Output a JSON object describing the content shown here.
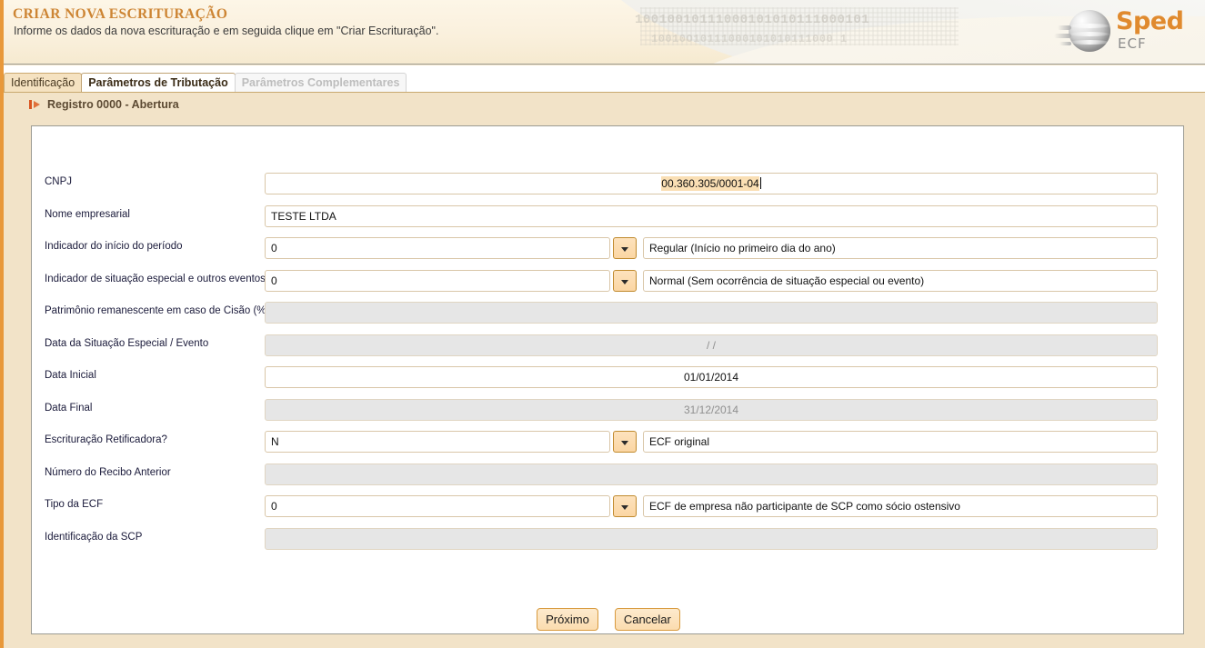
{
  "header": {
    "title": "CRIAR NOVA ESCRITURAÇÃO",
    "subtitle": "Informe os dados da nova escrituração e em seguida clique em \"Criar Escrituração\".",
    "watermark_top": "10010010111000101010111000101",
    "watermark_bottom": "10010O10111000101010111000 1",
    "logo": {
      "brand": "Sped",
      "product": "ECF"
    }
  },
  "tabs": [
    {
      "label": "Identificação",
      "state": "active"
    },
    {
      "label": "Parâmetros de Tributação",
      "state": "normal"
    },
    {
      "label": "Parâmetros Complementares",
      "state": "disabled"
    }
  ],
  "section": {
    "icon": "flag-marker-icon",
    "title": "Registro 0000 - Abertura"
  },
  "form": {
    "rows": [
      {
        "label": "CNPJ",
        "kind": "single-wide",
        "value": "00.360.305/0001-04",
        "align": "center",
        "highlighted": true,
        "caret": true,
        "disabled": false
      },
      {
        "label": "Nome empresarial",
        "kind": "single-wide",
        "value": "TESTE LTDA",
        "align": "left",
        "highlighted": false,
        "caret": false,
        "disabled": false
      },
      {
        "label": "Indicador do início do período",
        "kind": "code-desc",
        "value": "0",
        "description": "Regular (Início no primeiro dia do ano)",
        "disabled": false
      },
      {
        "label": "Indicador de situação especial e outros eventos",
        "kind": "code-desc",
        "value": "0",
        "description": "Normal (Sem ocorrência de situação especial ou evento)",
        "disabled": false
      },
      {
        "label": "Patrimônio remanescente em caso de Cisão (%)",
        "kind": "single-wide",
        "value": "",
        "align": "left",
        "highlighted": false,
        "caret": false,
        "disabled": true
      },
      {
        "label": "Data da Situação Especial / Evento",
        "kind": "single-wide",
        "value": "/  /",
        "align": "center",
        "highlighted": false,
        "caret": false,
        "disabled": true
      },
      {
        "label": "Data Inicial",
        "kind": "single-wide",
        "value": "01/01/2014",
        "align": "center",
        "highlighted": false,
        "caret": false,
        "disabled": false
      },
      {
        "label": "Data Final",
        "kind": "single-wide",
        "value": "31/12/2014",
        "align": "center",
        "highlighted": false,
        "caret": false,
        "disabled": true
      },
      {
        "label": "Escrituração Retificadora?",
        "kind": "code-desc",
        "value": "N",
        "description": "ECF original",
        "disabled": false
      },
      {
        "label": "Número do Recibo Anterior",
        "kind": "single-wide",
        "value": "",
        "align": "left",
        "highlighted": false,
        "caret": false,
        "disabled": true
      },
      {
        "label": "Tipo da ECF",
        "kind": "code-desc",
        "value": "0",
        "description": "ECF de empresa não participante de SCP como sócio ostensivo",
        "disabled": false
      },
      {
        "label": "Identificação da SCP",
        "kind": "single-wide",
        "value": "",
        "align": "left",
        "highlighted": false,
        "caret": false,
        "disabled": true
      }
    ]
  },
  "buttons": {
    "next_label": "Próximo",
    "cancel_label": "Cancelar"
  },
  "colors": {
    "accent_orange": "#e8983a",
    "title_orange": "#cd8534",
    "page_bg": "#f2e3c8",
    "panel_bg": "#ffffff",
    "disabled_field": "#e6e6e6",
    "highlight": "#fadfb4"
  }
}
